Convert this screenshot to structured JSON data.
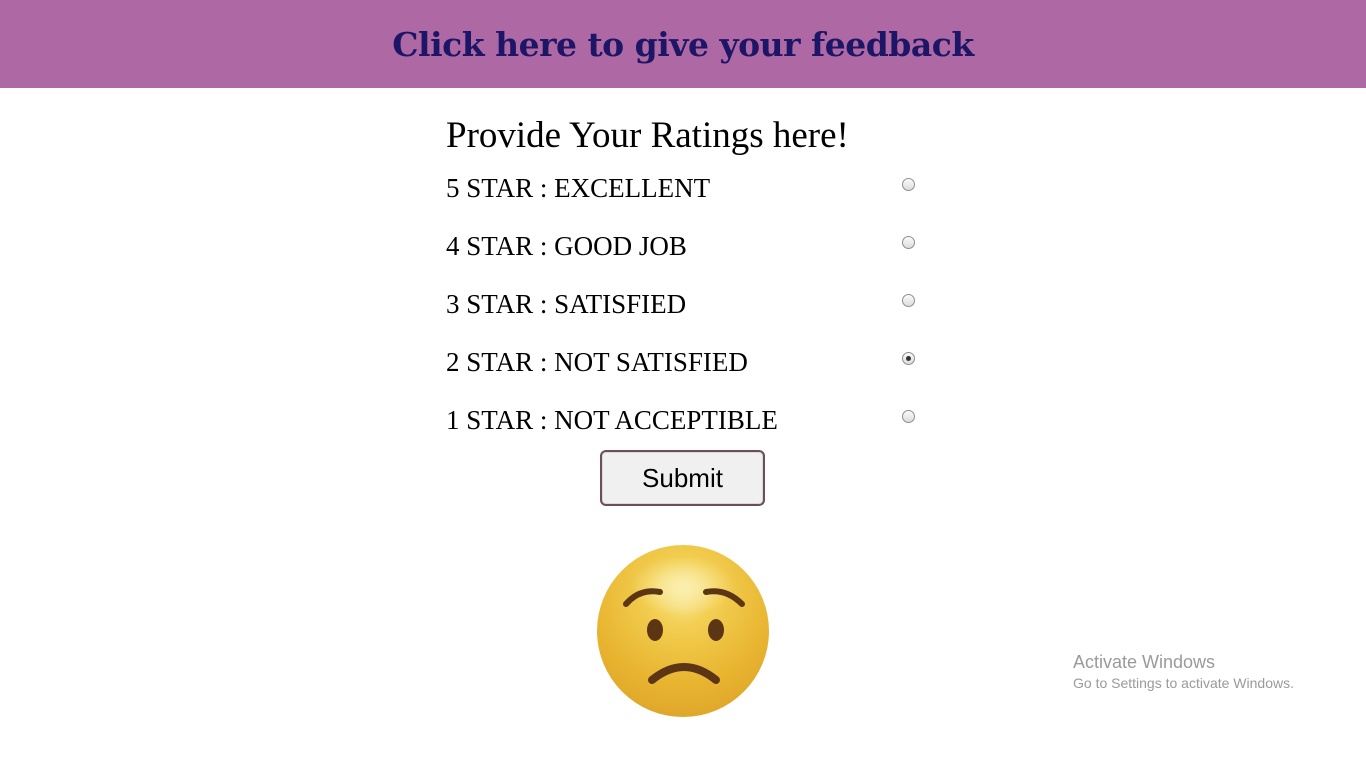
{
  "header": {
    "link_text": "Click here to give your feedback",
    "background_color": "#ae68a3",
    "text_color": "#1d1566"
  },
  "main": {
    "heading": "Provide Your Ratings here!",
    "ratings": [
      {
        "label": "5 STAR : EXCELLENT",
        "checked": false
      },
      {
        "label": "4 STAR : GOOD JOB",
        "checked": false
      },
      {
        "label": "3 STAR : SATISFIED",
        "checked": false
      },
      {
        "label": "2 STAR : NOT SATISFIED",
        "checked": true
      },
      {
        "label": "1 STAR : NOT ACCEPTIBLE",
        "checked": false
      }
    ],
    "submit_label": "Submit",
    "emoji_icon": "worried-face-icon"
  },
  "watermark": {
    "title": "Activate Windows",
    "subtitle": "Go to Settings to activate Windows."
  }
}
